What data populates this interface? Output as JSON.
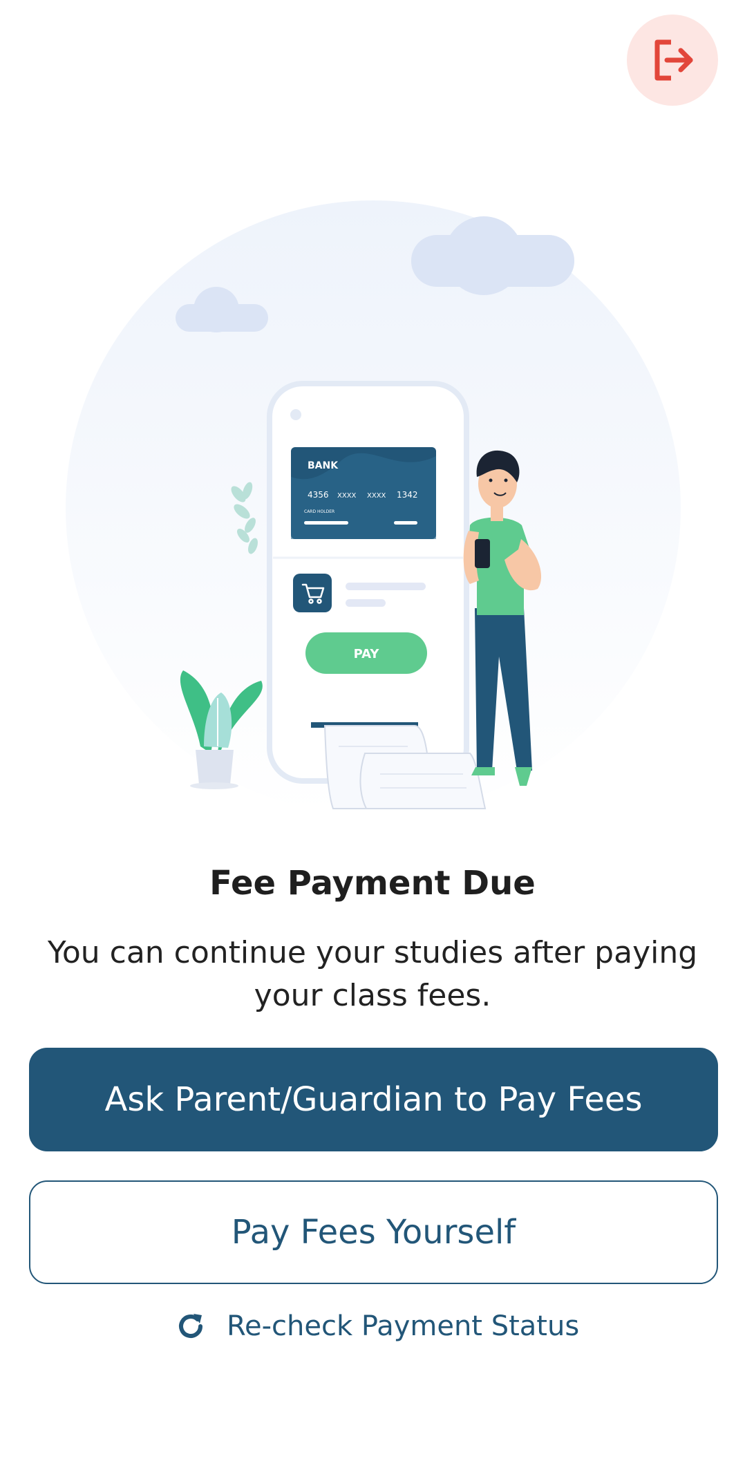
{
  "header": {
    "logout_icon": "logout-icon"
  },
  "illustration": {
    "card_bank": "BANK",
    "card_number": [
      "4356",
      "XXXX",
      "XXXX",
      "1342"
    ],
    "card_holder": "CARD HOLDER",
    "pay_label": "PAY",
    "cart_icon": "cart-icon"
  },
  "content": {
    "title": "Fee Payment Due",
    "subtitle_line1": "You can continue your studies after paying",
    "subtitle_line2": "your class fees."
  },
  "actions": {
    "ask_parent_label": "Ask Parent/Guardian to Pay Fees",
    "pay_yourself_label": "Pay Fees Yourself",
    "recheck_label": "Re-check Payment Status",
    "recheck_icon": "refresh-icon"
  },
  "colors": {
    "primary": "#225678",
    "logout_bg": "#fde6e3",
    "logout_icon": "#e2463a",
    "accent_green": "#5fcb8f"
  }
}
